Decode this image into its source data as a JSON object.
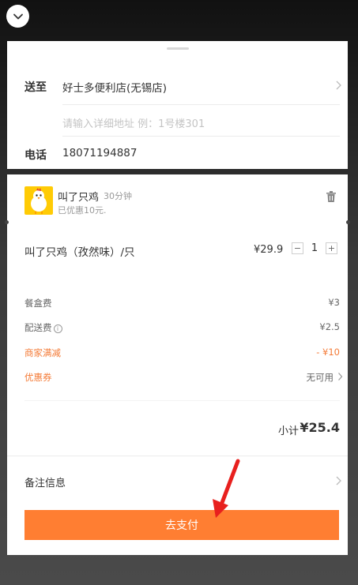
{
  "delivery": {
    "to_label": "送至",
    "address": "好士多便利店(无锡店)",
    "detail_placeholder": "请输入详细地址 例：1号楼301",
    "phone_label": "电话",
    "phone": "18071194887"
  },
  "shop": {
    "name": "叫了只鸡",
    "time": "30分钟",
    "discount": "已优惠10元.",
    "logo_icon": "chicken-logo-icon"
  },
  "item": {
    "name": "叫了只鸡（孜然味）/只",
    "price": "¥29.9",
    "minus": "−",
    "quantity": "1",
    "plus": "+"
  },
  "fees": {
    "box_label": "餐盒费",
    "box_value": "¥3",
    "delivery_label": "配送费",
    "delivery_info": "i",
    "delivery_value": "¥2.5",
    "merchant_label": "商家满减",
    "merchant_value": "- ¥10",
    "coupon_label": "优惠券",
    "coupon_value": "无可用"
  },
  "subtotal": {
    "label": "小计",
    "value": "¥25.4"
  },
  "notes": {
    "label": "备注信息"
  },
  "pay": {
    "label": "去支付"
  },
  "colors": {
    "accent": "#ff7e32",
    "discount_text": "#f47a36",
    "annotation_arrow": "#e8201e"
  }
}
